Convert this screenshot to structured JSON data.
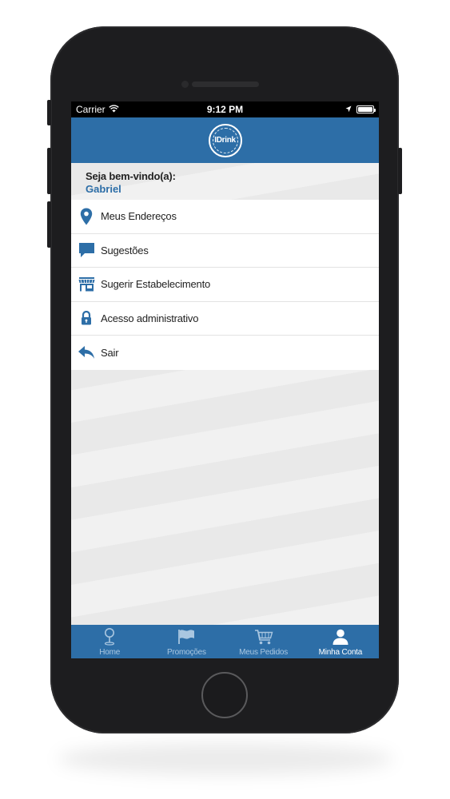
{
  "status_bar": {
    "carrier": "Carrier",
    "time": "9:12 PM",
    "battery_level": 1.0
  },
  "header": {
    "logo_text": "IDrink"
  },
  "welcome": {
    "title": "Seja bem-vindo(a):",
    "name": "Gabriel"
  },
  "menu": {
    "items": [
      {
        "label": "Meus Endereços",
        "icon": "location-pin-icon"
      },
      {
        "label": "Sugestões",
        "icon": "chat-bubble-icon"
      },
      {
        "label": "Sugerir Estabelecimento",
        "icon": "store-icon"
      },
      {
        "label": "Acesso administrativo",
        "icon": "lock-icon"
      },
      {
        "label": "Sair",
        "icon": "reply-arrow-icon"
      }
    ]
  },
  "tab_bar": {
    "tabs": [
      {
        "label": "Home",
        "icon": "map-pin-icon",
        "active": false
      },
      {
        "label": "Promoções",
        "icon": "flag-icon",
        "active": false
      },
      {
        "label": "Meus Pedidos",
        "icon": "cart-icon",
        "active": false
      },
      {
        "label": "Minha Conta",
        "icon": "user-icon",
        "active": true
      }
    ]
  },
  "colors": {
    "accent": "#2d6ea7",
    "tab_inactive": "#a9c6e0",
    "tab_active": "#ffffff"
  }
}
